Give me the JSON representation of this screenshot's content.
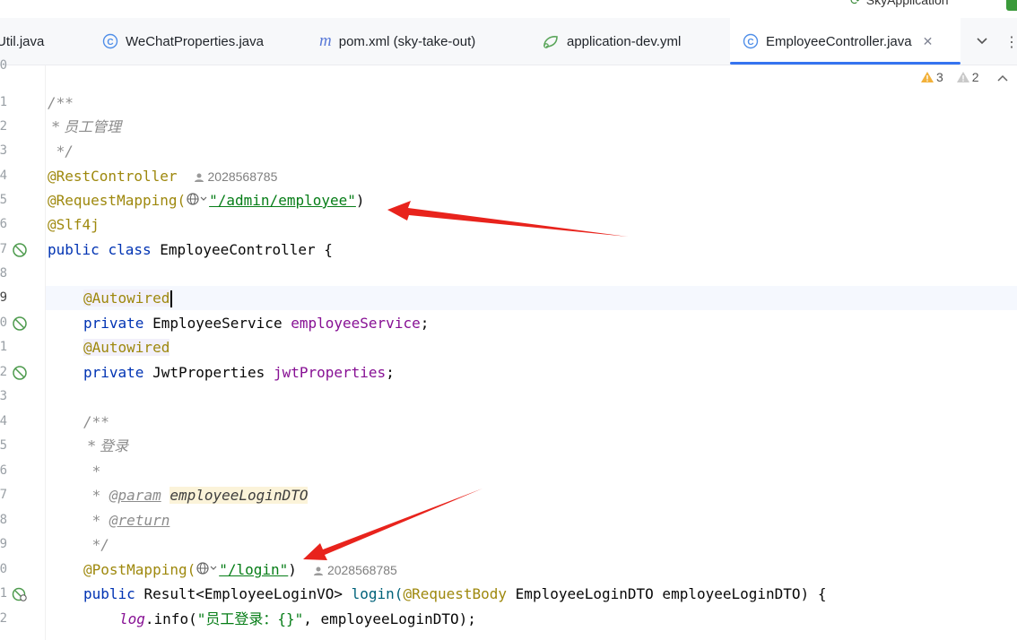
{
  "top": {
    "run_config": "SkyApplication"
  },
  "tabs": [
    {
      "label": "Util.java",
      "icon": "java-class-icon"
    },
    {
      "label": "WeChatProperties.java",
      "icon": "class-icon"
    },
    {
      "label": "pom.xml (sky-take-out)",
      "icon": "maven-icon"
    },
    {
      "label": "application-dev.yml",
      "icon": "spring-config-icon"
    },
    {
      "label": "EmployeeController.java",
      "icon": "class-icon",
      "active": true
    }
  ],
  "inspections": {
    "warnings": "3",
    "weak_warnings": "2"
  },
  "editor": {
    "line_numbers": [
      "0",
      "1",
      "2",
      "3",
      "4",
      "5",
      "6",
      "7",
      "8",
      "9",
      "0",
      "1",
      "2",
      "3",
      "4",
      "5",
      "6",
      "7",
      "8",
      "9",
      "0",
      "1",
      "2"
    ],
    "comment_open": "/**",
    "class_doc": " * 员工管理",
    "comment_close": " */",
    "ann_rest": "@RestController",
    "author": "2028568785",
    "ann_mapping": "@RequestMapping(",
    "mapping_path": "\"/admin/employee\"",
    "close_paren": ")",
    "ann_slf4j": "@Slf4j",
    "kw_public": "public",
    "kw_class": "class",
    "class_name": "EmployeeController {",
    "ann_autowired": "@Autowired",
    "kw_private": "private",
    "type_service": "EmployeeService",
    "field_service": "employeeService",
    "type_jwt": "JwtProperties",
    "field_jwt": "jwtProperties",
    "semicolon": ";",
    "doc_open": "/**",
    "method_doc": " * 登录",
    "doc_star": " *",
    "doc_star_sp": " * ",
    "tag_param": "@param",
    "param_name": "employeeLoginDTO",
    "tag_return": "@return",
    "doc_close": " */",
    "ann_post": "@PostMapping(",
    "post_path": "\"/login\"",
    "result_type": "Result<EmployeeLoginVO>",
    "method_name": "login(",
    "ann_body": "@RequestBody",
    "param_sig": "EmployeeLoginDTO employeeLoginDTO) {",
    "log_var": "log",
    "log_call": ".info(",
    "log_string": "\"员工登录：{}\"",
    "log_args": ", employeeLoginDTO);"
  },
  "colors": {
    "accent": "#3574f0",
    "arrow": "#e8231c"
  }
}
